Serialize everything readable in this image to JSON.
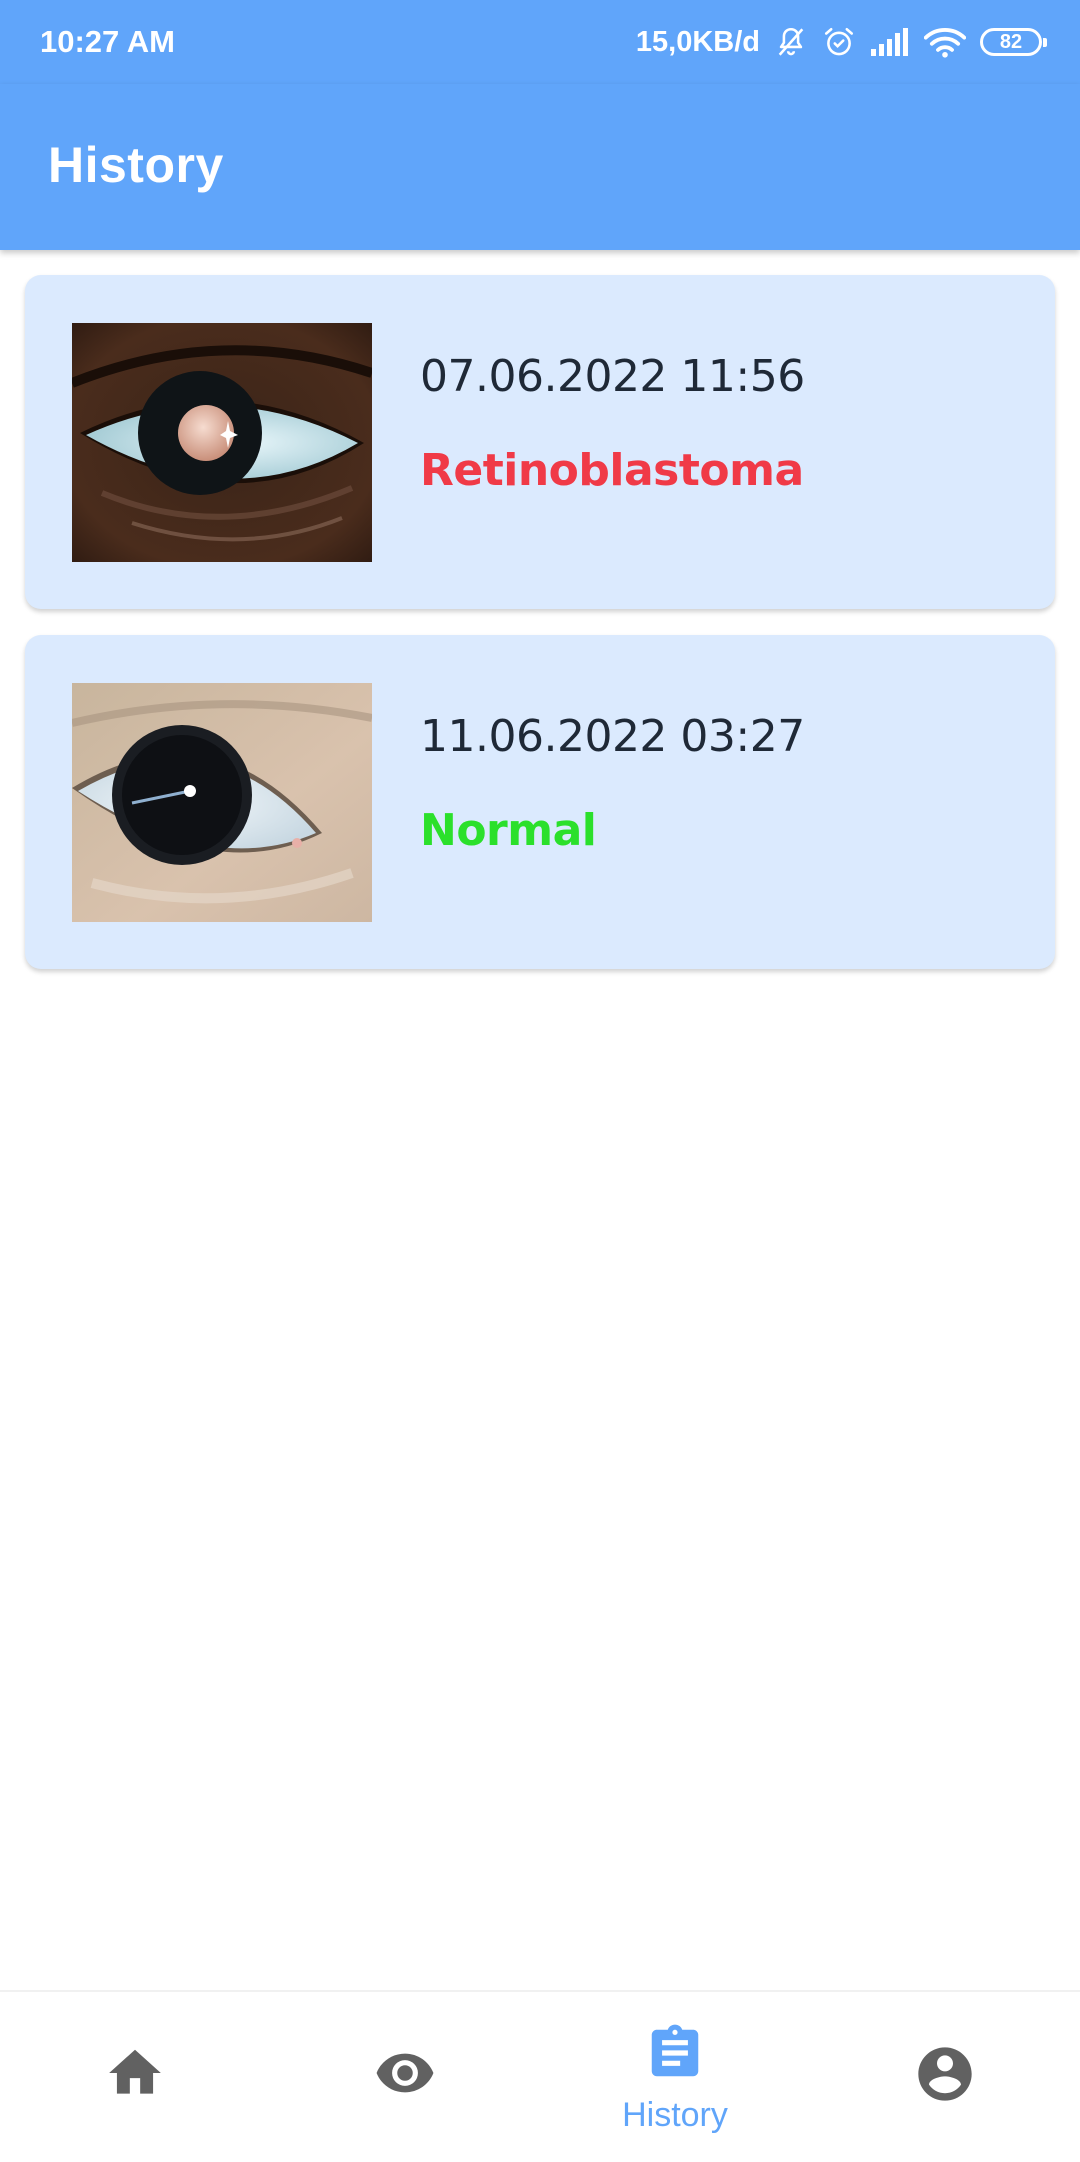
{
  "status_bar": {
    "time": "10:27 AM",
    "network_speed": "15,0KB/d",
    "battery_level": "82",
    "icons": [
      "mute-bell-icon",
      "alarm-icon",
      "signal-icon",
      "wifi-icon",
      "battery-icon"
    ]
  },
  "app_bar": {
    "title": "History"
  },
  "history": {
    "items": [
      {
        "date": "07.06.2022 11:56",
        "result": "Retinoblastoma",
        "result_color": "#f03a47",
        "thumbnail": "eye-photo-leukocoria"
      },
      {
        "date": "11.06.2022 03:27",
        "result": "Normal",
        "result_color": "#2be02b",
        "thumbnail": "eye-photo-normal"
      }
    ]
  },
  "bottom_nav": {
    "items": [
      {
        "icon": "home-icon",
        "label": "",
        "active": false
      },
      {
        "icon": "eye-icon",
        "label": "",
        "active": false
      },
      {
        "icon": "clipboard-icon",
        "label": "History",
        "active": true
      },
      {
        "icon": "account-icon",
        "label": "",
        "active": false
      }
    ]
  },
  "colors": {
    "primary": "#60a5fa",
    "card_background": "#dbeafe",
    "inactive_icon": "#616161"
  }
}
